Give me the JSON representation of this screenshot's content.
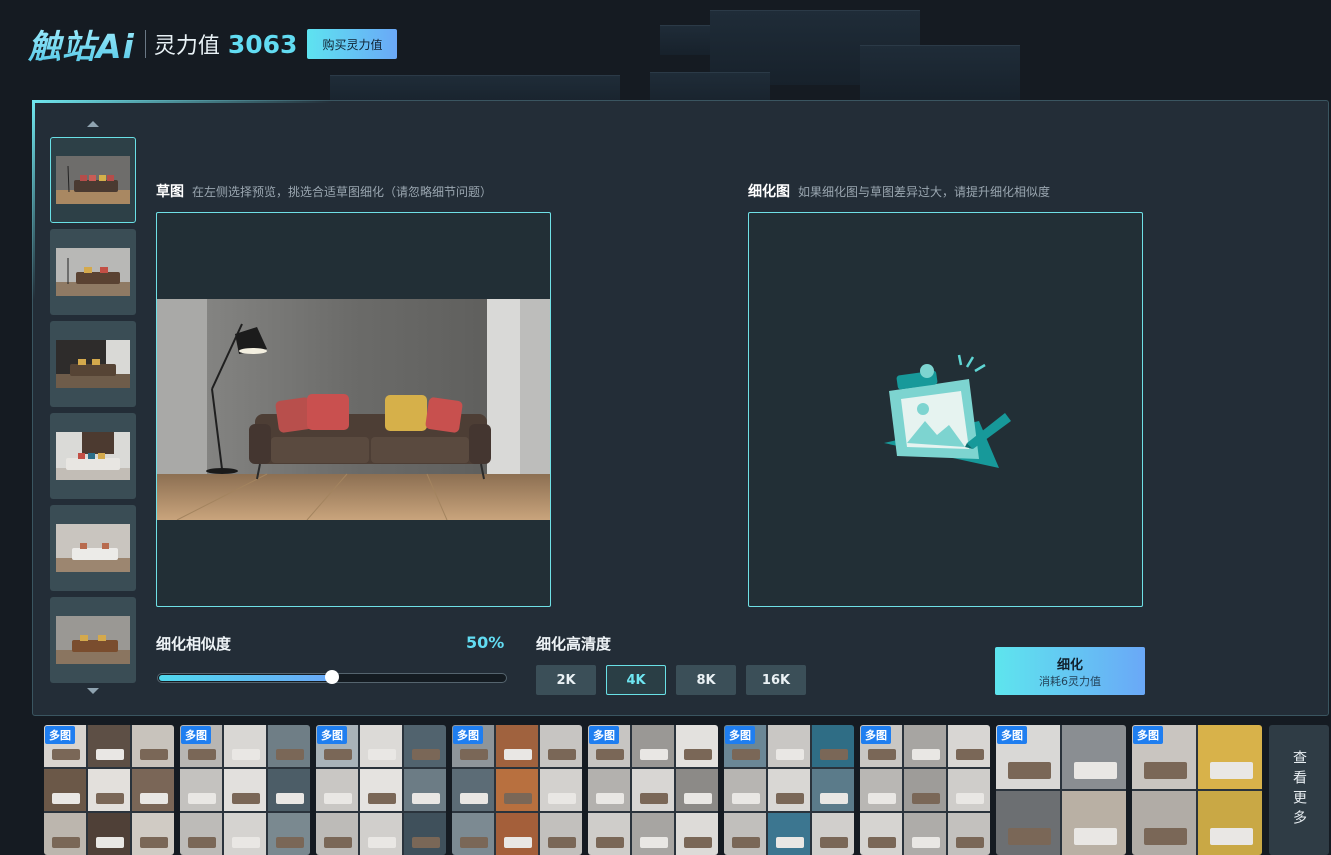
{
  "header": {
    "logo": "触站Ai",
    "power_label": "灵力值",
    "power_value": "3063",
    "buy_label": "购买灵力值"
  },
  "sketch": {
    "title": "草图",
    "hint": "在左侧选择预览，挑选合适草图细化（请忽略细节问题）"
  },
  "refined": {
    "title": "细化图",
    "hint": "如果细化图与草图差异过大，请提升细化相似度"
  },
  "controls": {
    "similarity_label": "细化相似度",
    "similarity_value": "50%",
    "similarity_level": 0.5,
    "resolution_label": "细化高清度",
    "resolutions": [
      "2K",
      "4K",
      "8K",
      "16K"
    ],
    "selected_resolution": "4K",
    "refine_label": "细化",
    "refine_cost": "消耗6灵力值"
  },
  "gallery": {
    "badge": "多图",
    "more_label": "查看更多",
    "card_count": 9
  },
  "colors": {
    "accent": "#62dcf2",
    "panel": "#232d37",
    "badge": "#1f7ef0"
  }
}
